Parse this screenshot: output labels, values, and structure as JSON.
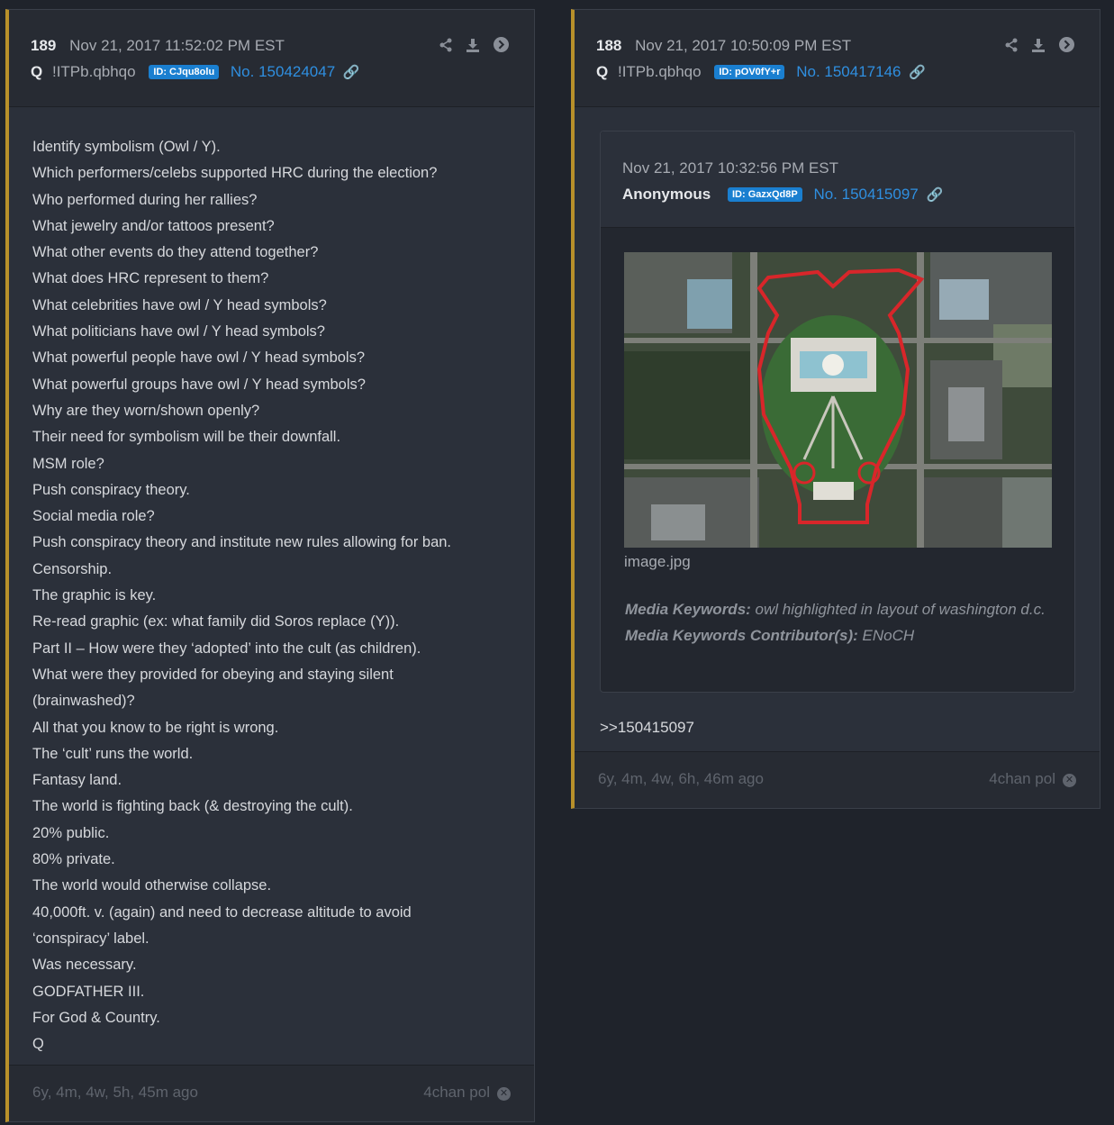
{
  "posts": [
    {
      "number": "189",
      "date": "Nov 21, 2017 11:52:02 PM EST",
      "author": "Q",
      "tripcode": "!ITPb.qbhqo",
      "id_badge": "ID: CJqu8olu",
      "post_no": "No. 150424047",
      "body_lines": [
        "Identify symbolism (Owl / Y).",
        "Which performers/celebs supported HRC during the election?",
        "Who performed during her rallies?",
        "What jewelry and/or tattoos present?",
        "What other events do they attend together?",
        "What does HRC represent to them?",
        "What celebrities have owl / Y head symbols?",
        "What politicians have owl / Y head symbols?",
        "What powerful people have owl / Y head symbols?",
        "What powerful groups have owl / Y head symbols?",
        "Why are they worn/shown openly?",
        "Their need for symbolism will be their downfall.",
        "MSM role?",
        "Push conspiracy theory.",
        "Social media role?",
        "Push conspiracy theory and institute new rules allowing for ban.",
        "Censorship.",
        "The graphic is key.",
        "Re-read graphic (ex: what family did Soros replace (Y)).",
        "Part II – How were they ‘adopted’ into the cult (as children).",
        "What were they provided for obeying and staying silent",
        "(brainwashed)?",
        "All that you know to be right is wrong.",
        "The ‘cult’ runs the world.",
        "Fantasy land.",
        "The world is fighting back (& destroying the cult).",
        "20% public.",
        "80% private.",
        "The world would otherwise collapse.",
        "40,000ft. v. (again) and need to decrease altitude to avoid",
        "‘conspiracy’ label.",
        "Was necessary.",
        "GODFATHER III.",
        "For God & Country.",
        "Q"
      ],
      "ago": "6y, 4m, 4w, 5h, 45m ago",
      "source": "4chan pol"
    },
    {
      "number": "188",
      "date": "Nov 21, 2017 10:50:09 PM EST",
      "author": "Q",
      "tripcode": "!ITPb.qbhqo",
      "id_badge": "ID: pOV0fY+r",
      "post_no": "No. 150417146",
      "quoted": {
        "date": "Nov 21, 2017 10:32:56 PM EST",
        "author": "Anonymous",
        "id_badge": "ID: GazxQd8P",
        "post_no": "No. 150415097",
        "image_filename": "image.jpg",
        "keywords_label": "Media Keywords:",
        "keywords_value": "owl highlighted in layout of washington d.c.",
        "contributors_label": "Media Keywords Contributor(s):",
        "contributors_value": "ENoCH"
      },
      "reply_ref": ">>150415097",
      "ago": "6y, 4m, 4w, 6h, 46m ago",
      "source": "4chan pol"
    }
  ],
  "icons": {
    "share": "share-icon",
    "download": "download-icon",
    "goto": "arrow-right-circle-icon",
    "link": "link-icon",
    "close": "close-circle-icon"
  },
  "colors": {
    "accent_border": "#b8902a",
    "id_badge": "#1a7fd0",
    "link": "#2f8fe0",
    "owl_outline": "#d8262a"
  }
}
